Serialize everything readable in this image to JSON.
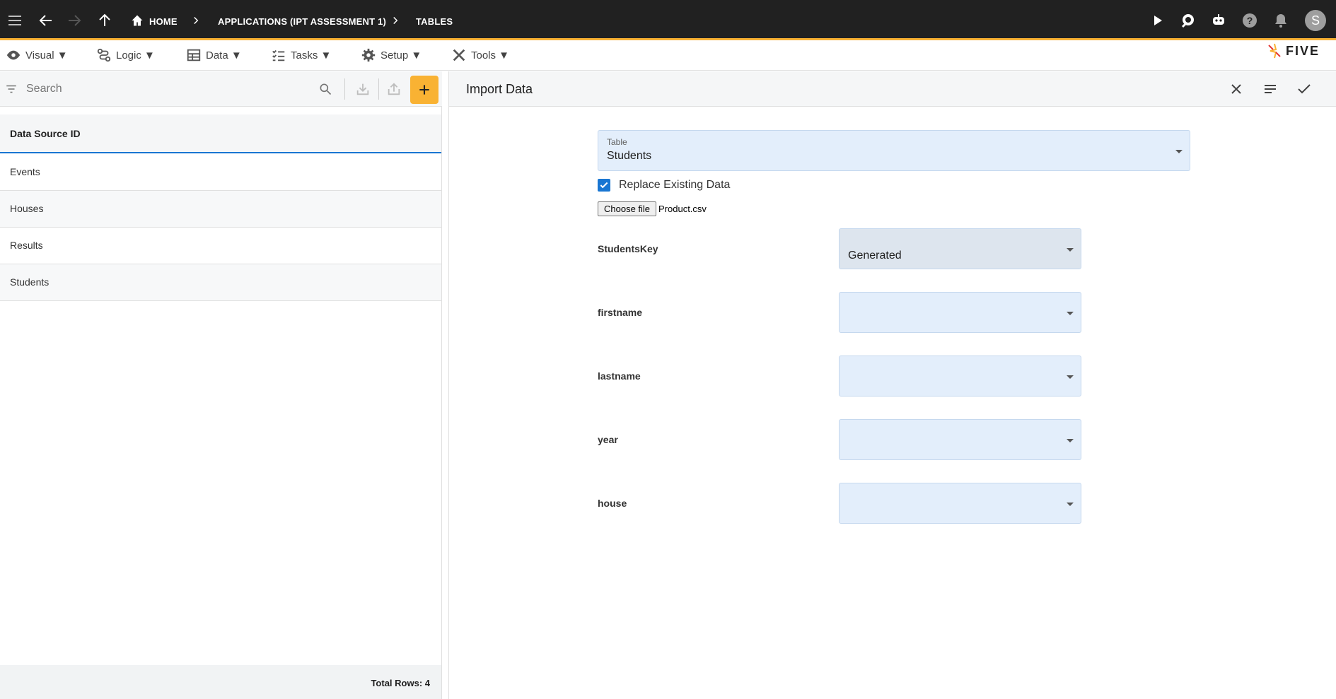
{
  "breadcrumbs": {
    "home": "HOME",
    "app": "APPLICATIONS (IPT ASSESSMENT 1)",
    "tables": "TABLES"
  },
  "user": {
    "initial": "S"
  },
  "menu": {
    "visual": "Visual ▼",
    "logic": "Logic ▼",
    "data": "Data ▼",
    "tasks": "Tasks ▼",
    "setup": "Setup ▼",
    "tools": "Tools ▼"
  },
  "brand": {
    "logo_text": "FIVE"
  },
  "list": {
    "search_placeholder": "Search",
    "column_header": "Data Source ID",
    "rows": [
      "Events",
      "Houses",
      "Results",
      "Students"
    ],
    "total_rows": "Total Rows: 4"
  },
  "form": {
    "title": "Import Data",
    "table_label": "Table",
    "table_value": "Students",
    "replace_label": "Replace Existing Data",
    "choose_file_label": "Choose file",
    "file_name": "Product.csv",
    "fields": [
      {
        "label": "StudentsKey",
        "value": "Generated"
      },
      {
        "label": "firstname",
        "value": ""
      },
      {
        "label": "lastname",
        "value": ""
      },
      {
        "label": "year",
        "value": ""
      },
      {
        "label": "house",
        "value": ""
      }
    ]
  },
  "colors": {
    "topbar": "#212121",
    "accent": "#f9b233",
    "primary": "#1976d2",
    "field_bg": "#e3eefb"
  }
}
